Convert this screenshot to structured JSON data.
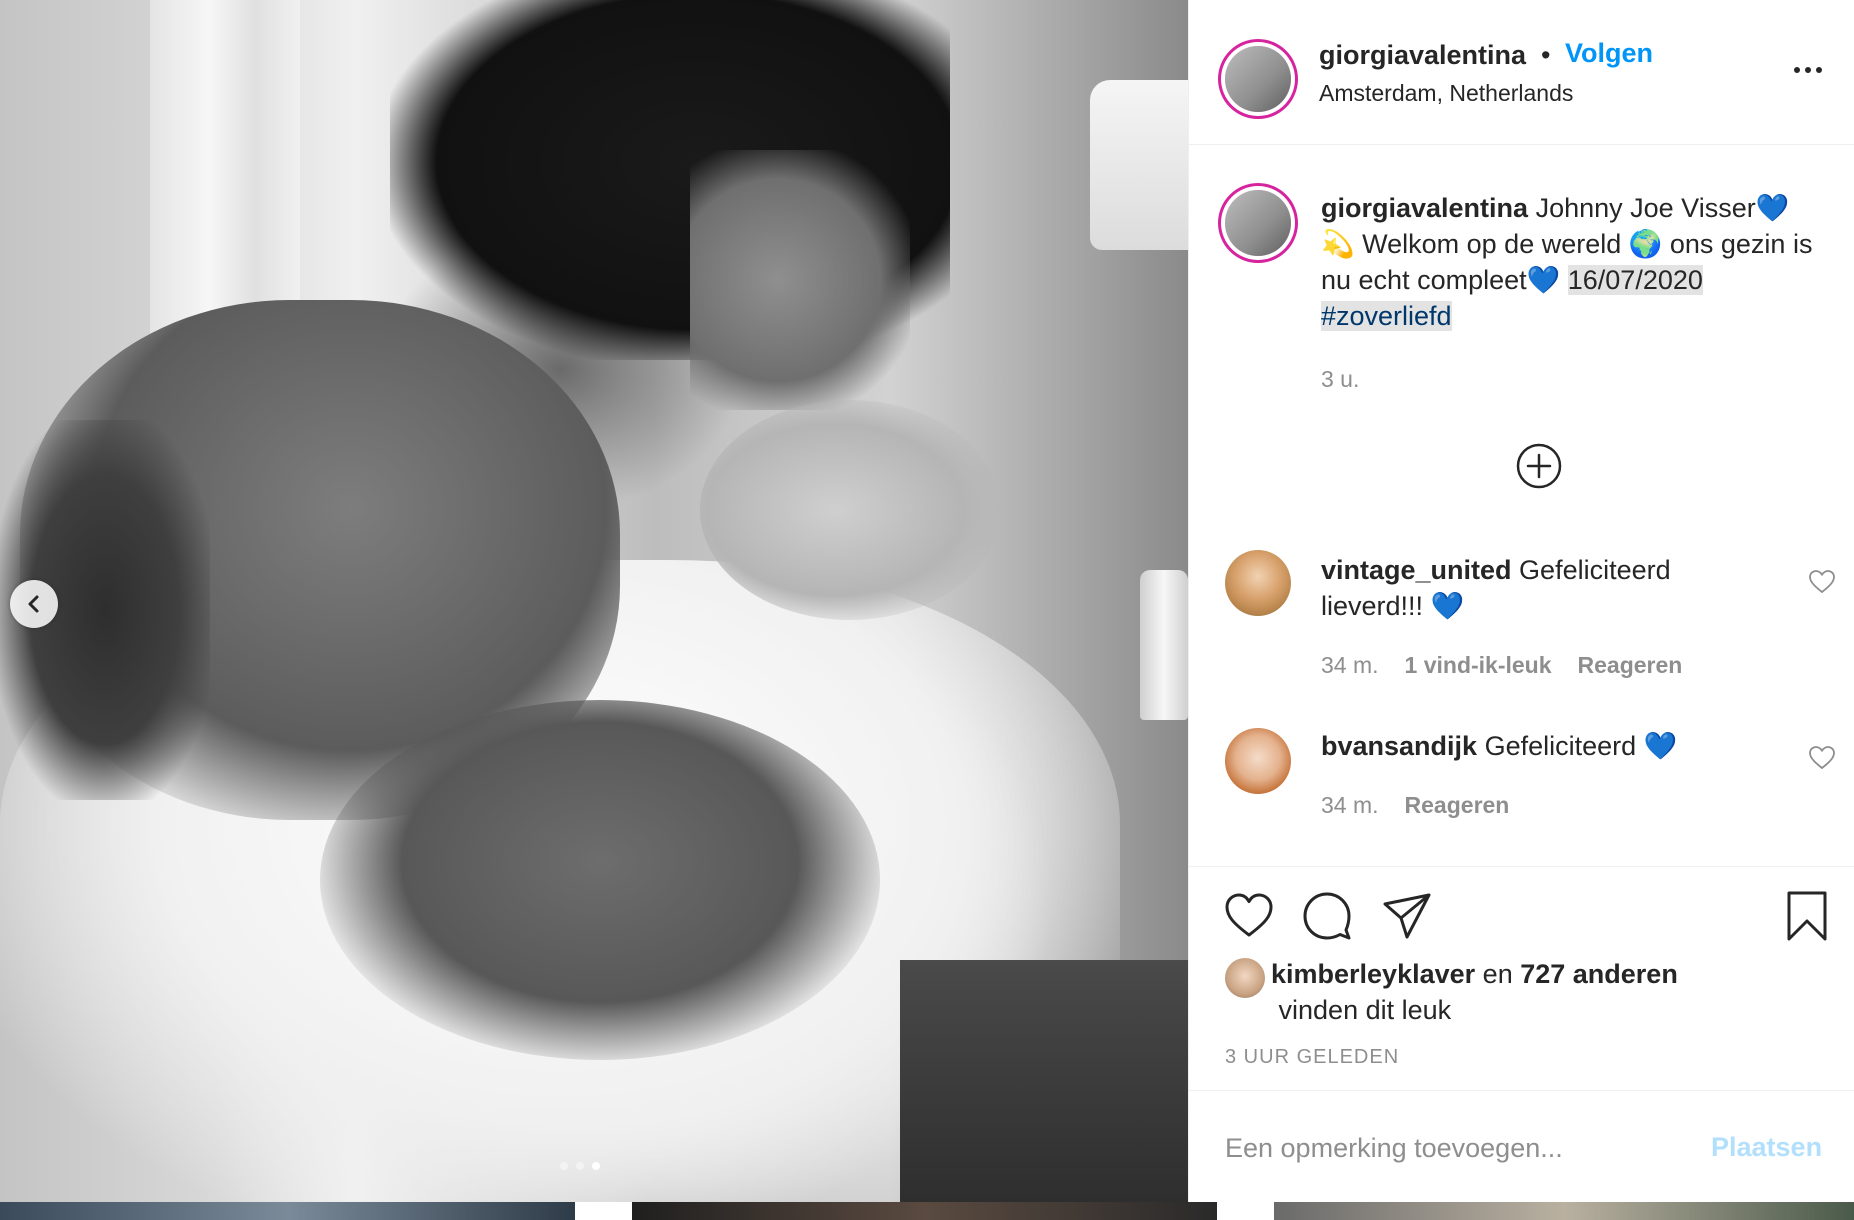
{
  "post": {
    "username": "giorgiavalentina",
    "separator": "•",
    "follow_label": "Volgen",
    "location": "Amsterdam, Netherlands",
    "more_label": "..."
  },
  "caption": {
    "username": "giorgiavalentina",
    "text_part1": "Johnny Joe Visser💙",
    "text_part2": "💫  Welkom op de wereld 🌍  ons gezin is nu echt compleet💙 ",
    "date_text": " 16/07/2020 ",
    "hashtag": "#zoverliefd",
    "time": "3 u."
  },
  "comments": [
    {
      "username": "vintage_united",
      "text": "Gefeliciteerd lieverd!!! 💙",
      "time": "34 m.",
      "likes": "1 vind-ik-leuk",
      "reply_label": "Reageren"
    },
    {
      "username": "bvansandijk",
      "text": "Gefeliciteerd 💙",
      "time": "34 m.",
      "reply_label": "Reageren"
    }
  ],
  "likes": {
    "liker": "kimberleyklaver",
    "connector": "en",
    "others": "727 anderen",
    "suffix": "vinden dit leuk"
  },
  "timestamp": "3 UUR GELEDEN",
  "comment_box": {
    "placeholder": "Een opmerking toevoegen...",
    "post_label": "Plaatsen"
  },
  "carousel": {
    "slide_count": 3,
    "active_slide": 3
  },
  "colors": {
    "link_blue": "#0095f6",
    "post_button_disabled": "#b2dffc",
    "secondary_text": "#8e8e8e",
    "hashtag": "#00376b"
  },
  "icons": {
    "prev": "chevron-left-icon",
    "more": "more-options-icon",
    "load_more": "plus-circle-icon",
    "like": "heart-icon",
    "comment": "comment-bubble-icon",
    "share": "paper-plane-icon",
    "save": "bookmark-icon"
  }
}
